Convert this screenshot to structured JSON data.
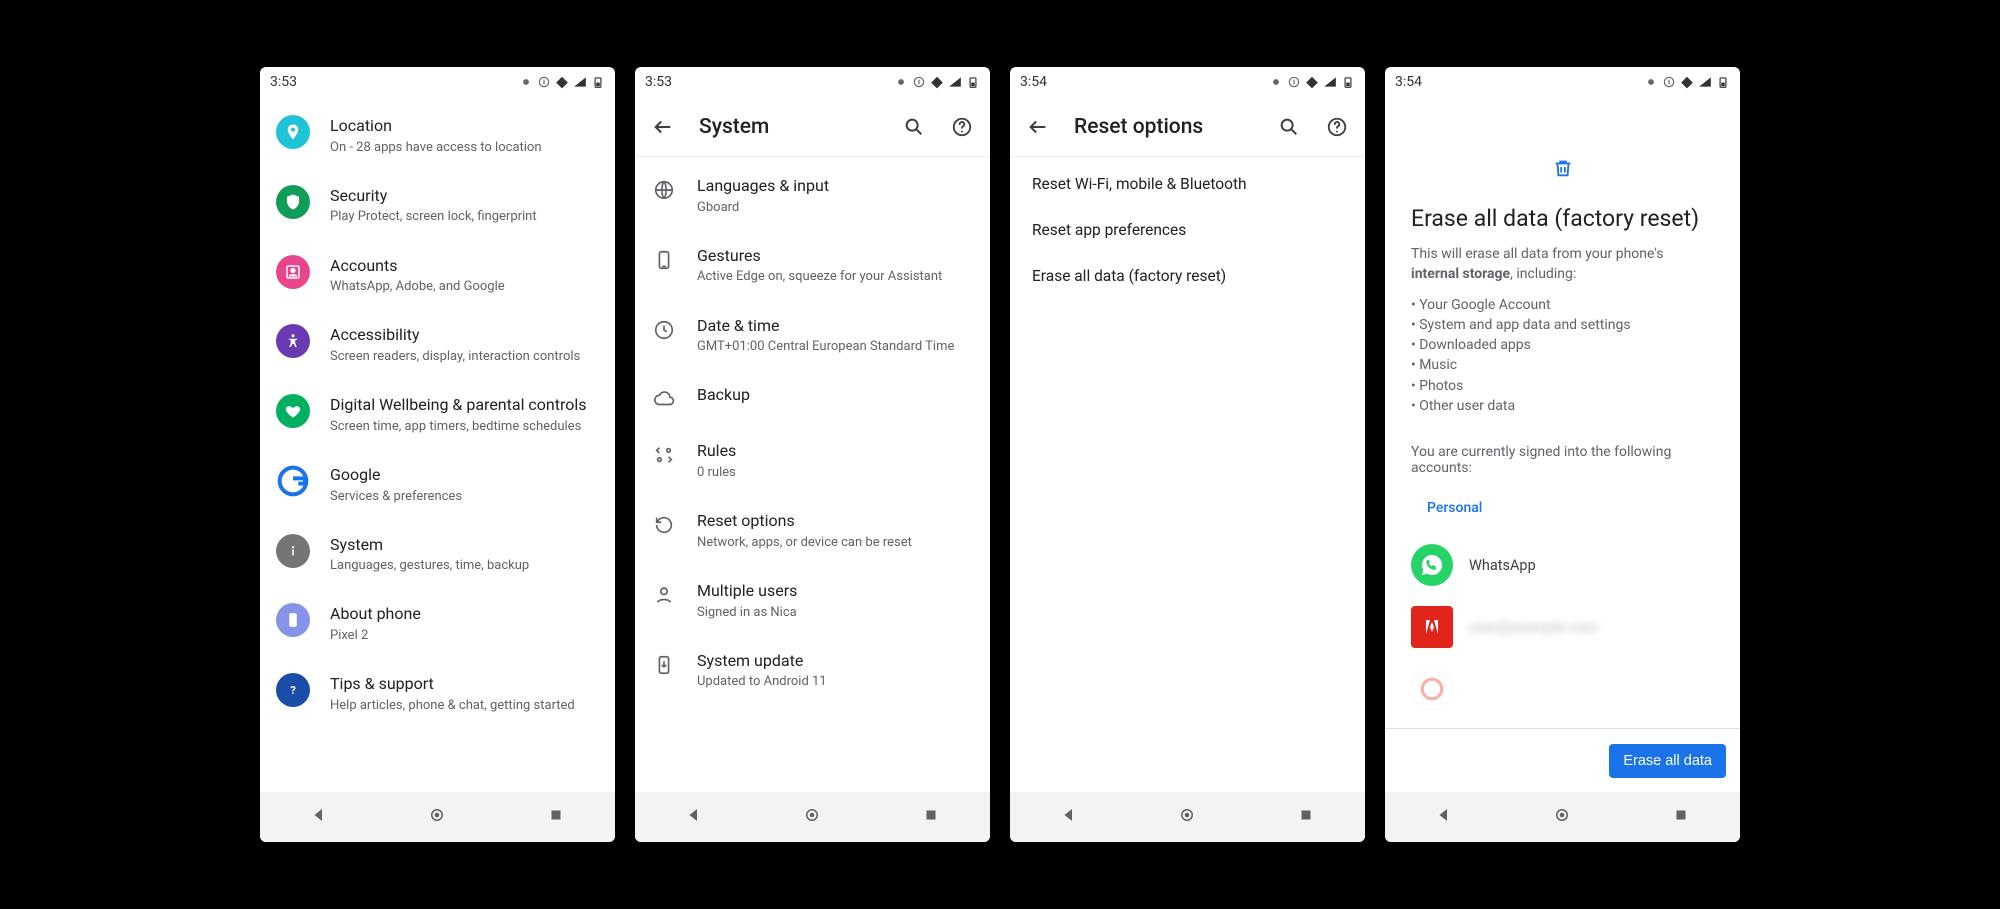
{
  "status": {
    "time1": "3:53",
    "time2": "3:53",
    "time3": "3:54",
    "time4": "3:54"
  },
  "screen1": {
    "items": [
      {
        "title": "Location",
        "sub": "On - 28 apps have access to location"
      },
      {
        "title": "Security",
        "sub": "Play Protect, screen lock, fingerprint"
      },
      {
        "title": "Accounts",
        "sub": "WhatsApp, Adobe, and Google"
      },
      {
        "title": "Accessibility",
        "sub": "Screen readers, display, interaction controls"
      },
      {
        "title": "Digital Wellbeing & parental controls",
        "sub": "Screen time, app timers, bedtime schedules"
      },
      {
        "title": "Google",
        "sub": "Services & preferences"
      },
      {
        "title": "System",
        "sub": "Languages, gestures, time, backup"
      },
      {
        "title": "About phone",
        "sub": "Pixel 2"
      },
      {
        "title": "Tips & support",
        "sub": "Help articles, phone & chat, getting started"
      }
    ]
  },
  "screen2": {
    "title": "System",
    "items": [
      {
        "title": "Languages & input",
        "sub": "Gboard"
      },
      {
        "title": "Gestures",
        "sub": "Active Edge on, squeeze for your Assistant"
      },
      {
        "title": "Date & time",
        "sub": "GMT+01:00 Central European Standard Time"
      },
      {
        "title": "Backup",
        "sub": ""
      },
      {
        "title": "Rules",
        "sub": "0 rules"
      },
      {
        "title": "Reset options",
        "sub": "Network, apps, or device can be reset"
      },
      {
        "title": "Multiple users",
        "sub": "Signed in as Nica"
      },
      {
        "title": "System update",
        "sub": "Updated to Android 11"
      }
    ]
  },
  "screen3": {
    "title": "Reset options",
    "items": [
      "Reset Wi-Fi, mobile & Bluetooth",
      "Reset app preferences",
      "Erase all data (factory reset)"
    ]
  },
  "screen4": {
    "heading": "Erase all data (factory reset)",
    "intro_pre": "This will erase all data from your phone's ",
    "intro_bold": "internal storage",
    "intro_post": ", including:",
    "bullets": [
      "Your Google Account",
      "System and app data and settings",
      "Downloaded apps",
      "Music",
      "Photos",
      "Other user data"
    ],
    "signed_intro": "You are currently signed into the following accounts:",
    "section_label": "Personal",
    "accounts": [
      {
        "name": "WhatsApp"
      },
      {
        "name": "user@example.com"
      }
    ],
    "cta": "Erase all data"
  }
}
